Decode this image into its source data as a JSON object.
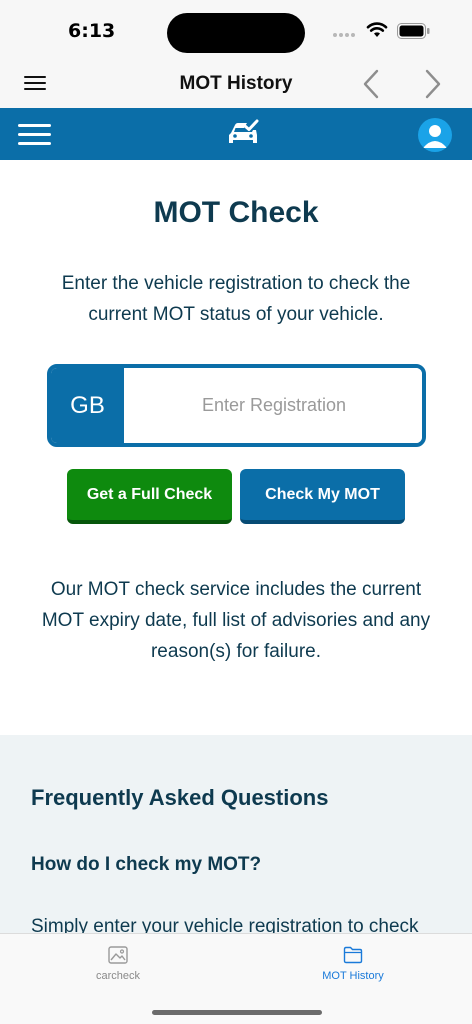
{
  "status_bar": {
    "time": "6:13",
    "icons": [
      "signal-dots-icon",
      "wifi-icon",
      "battery-icon"
    ]
  },
  "nav": {
    "title": "MOT History",
    "icons": [
      "menu-icon",
      "chevron-left-icon",
      "chevron-right-icon"
    ]
  },
  "site_header": {
    "logo_icon": "car-check-logo-icon",
    "account_icon": "account-icon",
    "color": "#0b6ea8"
  },
  "main": {
    "title": "MOT Check",
    "intro": "Enter the vehicle registration to check the current MOT status of your vehicle.",
    "registration": {
      "prefix": "GB",
      "placeholder": "Enter Registration",
      "value": ""
    },
    "buttons": {
      "full_check": "Get a Full Check",
      "check_mot": "Check My MOT"
    },
    "service_note": "Our MOT check service includes the current MOT expiry date, full list of advisories and any reason(s) for failure."
  },
  "faq": {
    "heading": "Frequently Asked Questions",
    "question": "How do I check my MOT?",
    "answer": "Simply enter your vehicle registration to check"
  },
  "tabs": [
    {
      "label": "carcheck",
      "icon": "image-icon",
      "selected": false
    },
    {
      "label": "MOT History",
      "icon": "folder-icon",
      "selected": true
    }
  ],
  "colors": {
    "brand_blue": "#0b6ea8",
    "green_button": "#0e8a0e",
    "heading_text": "#0e3a4f",
    "tab_selected": "#1a7ad9"
  }
}
